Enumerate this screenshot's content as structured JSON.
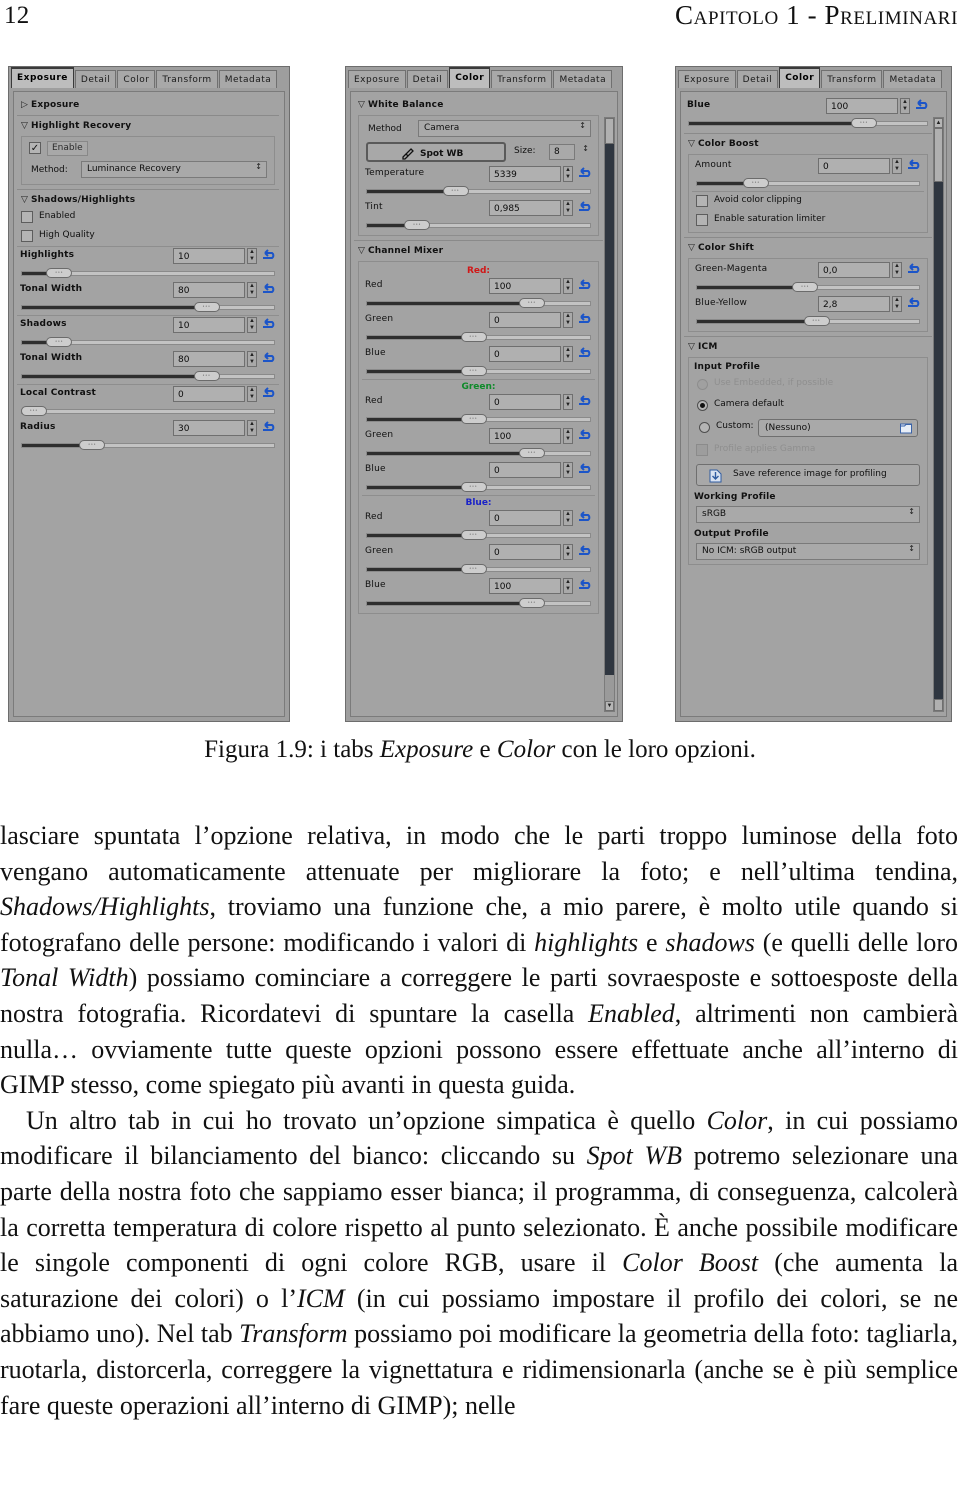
{
  "header": {
    "folio": "12",
    "chapter_title": "Capitolo 1 - Preliminari"
  },
  "figure": {
    "caption_prefix": "Figura 1.9: i tabs ",
    "caption_em1": "Exposure",
    "caption_mid": " e ",
    "caption_em2": "Color",
    "caption_suffix": " con le loro opzioni."
  },
  "panel1": {
    "tabs": [
      "Exposure",
      "Detail",
      "Color",
      "Transform",
      "Metadata"
    ],
    "active_tab": "Exposure",
    "groups": [
      {
        "title": "Exposure",
        "tri": "▷",
        "collapsed": true
      },
      {
        "title": "Highlight Recovery",
        "tri": "▽"
      },
      {
        "title": "Shadows/Highlights",
        "tri": "▽"
      }
    ],
    "enable_checkbox": {
      "label": "Enable",
      "checked": true,
      "mark": "✓"
    },
    "method": {
      "label": "Method:",
      "value": "Luminance Recovery"
    },
    "checkboxes": [
      {
        "label": "Enabled",
        "checked": false
      },
      {
        "label": "High Quality",
        "checked": false
      }
    ],
    "sliders": [
      {
        "label": "Highlights",
        "value": "10",
        "pct": 12
      },
      {
        "label": "Tonal Width",
        "value": "80",
        "pct": 72
      },
      {
        "label": "Shadows",
        "value": "10",
        "pct": 12
      },
      {
        "label": "Tonal Width",
        "value": "80",
        "pct": 72
      },
      {
        "label": "Local Contrast",
        "value": "0",
        "pct": 1
      },
      {
        "label": "Radius",
        "value": "30",
        "pct": 25
      }
    ]
  },
  "panel2": {
    "tabs": [
      "Exposure",
      "Detail",
      "Color",
      "Transform",
      "Metadata"
    ],
    "active_tab": "Color",
    "wb_group": "White Balance",
    "method": {
      "label": "Method",
      "value": "Camera"
    },
    "spot_wb": {
      "label": "Spot WB",
      "icon": "eyedropper-icon"
    },
    "size": {
      "label": "Size:",
      "value": "8"
    },
    "wb_sliders": [
      {
        "label": "Temperature",
        "value": "5339",
        "pct": 38
      },
      {
        "label": "Tint",
        "value": "0,985",
        "pct": 20
      }
    ],
    "mixer_group": "Channel Mixer",
    "mixer": [
      {
        "channel": "Red:",
        "color": "#d01818",
        "rows": [
          {
            "label": "Red",
            "value": "100",
            "pct": 72
          },
          {
            "label": "Green",
            "value": "0",
            "pct": 46
          },
          {
            "label": "Blue",
            "value": "0",
            "pct": 46
          }
        ]
      },
      {
        "channel": "Green:",
        "color": "#0f8a2a",
        "rows": [
          {
            "label": "Red",
            "value": "0",
            "pct": 46
          },
          {
            "label": "Green",
            "value": "100",
            "pct": 72
          },
          {
            "label": "Blue",
            "value": "0",
            "pct": 46
          }
        ]
      },
      {
        "channel": "Blue:",
        "color": "#1a22c8",
        "rows": [
          {
            "label": "Red",
            "value": "0",
            "pct": 46
          },
          {
            "label": "Green",
            "value": "0",
            "pct": 46
          },
          {
            "label": "Blue",
            "value": "100",
            "pct": 72
          }
        ]
      }
    ]
  },
  "panel3": {
    "tabs": [
      "Exposure",
      "Detail",
      "Color",
      "Transform",
      "Metadata"
    ],
    "active_tab": "Color",
    "top_slider": {
      "label": "Blue",
      "value": "100",
      "pct": 72
    },
    "boost_group": "Color Boost",
    "boost_amount": {
      "label": "Amount",
      "value": "0",
      "pct": 24
    },
    "boost_checks": [
      {
        "label": "Avoid color clipping",
        "checked": false
      },
      {
        "label": "Enable saturation limiter",
        "checked": false
      }
    ],
    "shift_group": "Color Shift",
    "shift_sliders": [
      {
        "label": "Green-Magenta",
        "value": "0,0",
        "pct": 47
      },
      {
        "label": "Blue-Yellow",
        "value": "2,8",
        "pct": 52
      }
    ],
    "icm_group": "ICM",
    "input_profile_label": "Input Profile",
    "radios": [
      {
        "label": "Use Embedded, if possible",
        "selected": false,
        "disabled": true
      },
      {
        "label": "Camera default",
        "selected": true,
        "disabled": false
      },
      {
        "label": "Custom:",
        "selected": false,
        "disabled": false
      }
    ],
    "custom_value": "(Nessuno)",
    "gamma_check": {
      "label": "Profile applies Gamma",
      "checked": false,
      "disabled": true
    },
    "save_button": "Save reference image for profiling",
    "working_profile_label": "Working Profile",
    "working_profile_value": "sRGB",
    "output_profile_label": "Output Profile",
    "output_profile_value": "No ICM: sRGB output"
  },
  "body": {
    "p1_a": "lasciare spuntata l’opzione relativa, in modo che le parti troppo luminose della foto vengano automaticamente attenuate per migliorare la foto; e nell’ultima tendina, ",
    "p1_em1": "Shadows/Highlights",
    "p1_b": ", troviamo una funzione che, a mio parere, è molto utile quando si fotografano delle persone: modificando i valori di ",
    "p1_em2": "highlights",
    "p1_c": " e ",
    "p1_em3": "shadows",
    "p1_d": " (e quelli delle loro ",
    "p1_em4": "Tonal Width",
    "p1_e": ") possiamo cominciare a correggere le parti sovraesposte e sottoesposte della nostra fotografia. Ricordatevi di spuntare la casella ",
    "p1_em5": "Enabled",
    "p1_f": ", altrimenti non cambierà nulla… ovviamente tutte queste opzioni possono essere effettuate anche all’interno di GIMP stesso, come spiegato più avanti in questa guida.",
    "p2_a": "Un altro tab in cui ho trovato un’opzione simpatica è quello ",
    "p2_em1": "Color",
    "p2_b": ", in cui possiamo modificare il bilanciamento del bianco: cliccando su ",
    "p2_em2": "Spot WB",
    "p2_c": " potremo selezionare una parte della nostra foto che sappiamo esser bianca; il programma, di conseguenza, calcolerà la corretta temperatura di colore rispetto al punto selezionato. È anche possibile modificare le singole componenti di ogni colore RGB, usare il ",
    "p2_em3": "Color Boost",
    "p2_d": " (che aumenta la saturazione dei colori) o l’",
    "p2_em4": "ICM",
    "p2_e": " (in cui possiamo impostare il profilo dei colori, se ne abbiamo uno). Nel tab ",
    "p2_em5": "Transform",
    "p2_f": " possiamo poi modificare la geometria della foto: tagliarla, ruotarla, distorcerla, correggere la vignettatura e ridimensionarla (anche se è più semplice fare queste operazioni all’interno di GIMP); nelle"
  }
}
